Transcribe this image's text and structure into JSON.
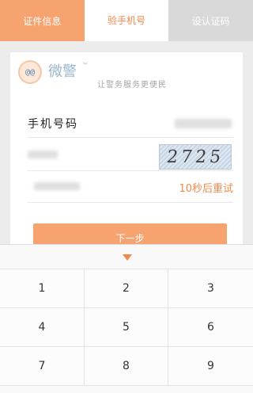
{
  "tabs": [
    {
      "label": "证件信息"
    },
    {
      "label": "验手机号"
    },
    {
      "label": "设认证码"
    }
  ],
  "brand": {
    "name": "微警",
    "tm": "™",
    "slogan": "让警务服务更便民",
    "logo_face": "@@"
  },
  "form": {
    "phone_label": "手机号码",
    "captcha_text": "2725",
    "retry_label": "10秒后重试",
    "next_label": "下一步"
  },
  "keyboard": {
    "keys": [
      "1",
      "2",
      "3",
      "4",
      "5",
      "6",
      "7",
      "8",
      "9"
    ]
  },
  "colors": {
    "accent": "#f7a36f",
    "accent_text": "#f08a4b"
  },
  "icons": {
    "keyboard_toggle": "chevron-down-icon"
  }
}
